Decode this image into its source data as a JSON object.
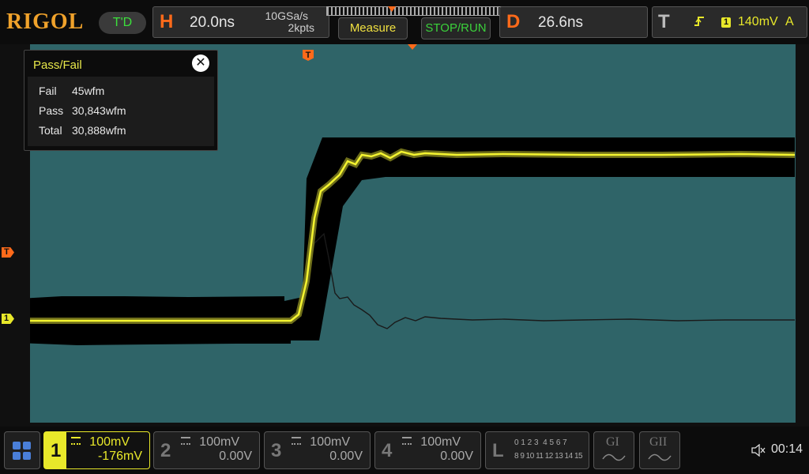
{
  "brand": {
    "logo": "RIGOL",
    "mode": "T'D"
  },
  "horizontal": {
    "letter": "H",
    "timebase": "20.0ns",
    "sample_rate": "10GSa/s",
    "memory_depth": "2kpts"
  },
  "buttons": {
    "measure": "Measure",
    "stop_run": "STOP/RUN"
  },
  "delay": {
    "letter": "D",
    "value": "26.6ns"
  },
  "trigger": {
    "letter": "T",
    "channel": "1",
    "level": "140mV",
    "mode": "A"
  },
  "passfail": {
    "title": "Pass/Fail",
    "close": "✕",
    "rows": [
      {
        "label": "Fail",
        "value": "45wfm"
      },
      {
        "label": "Pass",
        "value": "30,843wfm"
      },
      {
        "label": "Total",
        "value": "30,888wfm"
      }
    ]
  },
  "markers": {
    "trigger_top": "T",
    "trigger_left": "T",
    "channel1": "1"
  },
  "channels": [
    {
      "num": "1",
      "scale": "100mV",
      "offset": "-176mV",
      "color": "#e8e82a",
      "active": true
    },
    {
      "num": "2",
      "scale": "100mV",
      "offset": "0.00V",
      "color": "#555555",
      "active": false
    },
    {
      "num": "3",
      "scale": "100mV",
      "offset": "0.00V",
      "color": "#555555",
      "active": false
    },
    {
      "num": "4",
      "scale": "100mV",
      "offset": "0.00V",
      "color": "#555555",
      "active": false
    }
  ],
  "logic": {
    "letter": "L",
    "row1": "0 1 2 3  4 5 6 7",
    "row2": "8 9 10 11 12 13 14 15"
  },
  "generators": {
    "g1": "GI",
    "g2": "GII"
  },
  "status": {
    "time": "00:14"
  },
  "colors": {
    "screen": "#2f6468",
    "ch1": "#e8e82a",
    "accent": "#ff6a1a",
    "mask": "#000000"
  }
}
